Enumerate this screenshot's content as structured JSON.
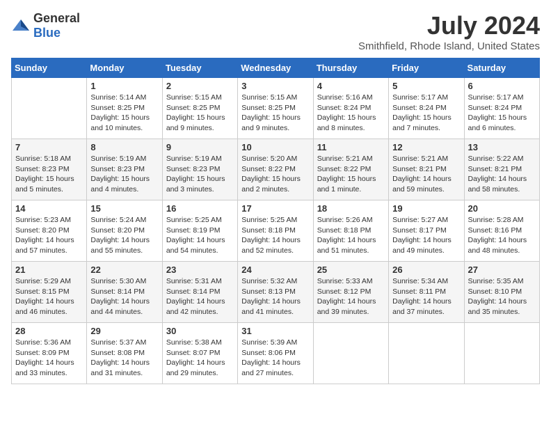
{
  "header": {
    "logo_general": "General",
    "logo_blue": "Blue",
    "month_title": "July 2024",
    "location": "Smithfield, Rhode Island, United States"
  },
  "days_of_week": [
    "Sunday",
    "Monday",
    "Tuesday",
    "Wednesday",
    "Thursday",
    "Friday",
    "Saturday"
  ],
  "weeks": [
    [
      {
        "day": "",
        "info": ""
      },
      {
        "day": "1",
        "info": "Sunrise: 5:14 AM\nSunset: 8:25 PM\nDaylight: 15 hours\nand 10 minutes."
      },
      {
        "day": "2",
        "info": "Sunrise: 5:15 AM\nSunset: 8:25 PM\nDaylight: 15 hours\nand 9 minutes."
      },
      {
        "day": "3",
        "info": "Sunrise: 5:15 AM\nSunset: 8:25 PM\nDaylight: 15 hours\nand 9 minutes."
      },
      {
        "day": "4",
        "info": "Sunrise: 5:16 AM\nSunset: 8:24 PM\nDaylight: 15 hours\nand 8 minutes."
      },
      {
        "day": "5",
        "info": "Sunrise: 5:17 AM\nSunset: 8:24 PM\nDaylight: 15 hours\nand 7 minutes."
      },
      {
        "day": "6",
        "info": "Sunrise: 5:17 AM\nSunset: 8:24 PM\nDaylight: 15 hours\nand 6 minutes."
      }
    ],
    [
      {
        "day": "7",
        "info": "Sunrise: 5:18 AM\nSunset: 8:23 PM\nDaylight: 15 hours\nand 5 minutes."
      },
      {
        "day": "8",
        "info": "Sunrise: 5:19 AM\nSunset: 8:23 PM\nDaylight: 15 hours\nand 4 minutes."
      },
      {
        "day": "9",
        "info": "Sunrise: 5:19 AM\nSunset: 8:23 PM\nDaylight: 15 hours\nand 3 minutes."
      },
      {
        "day": "10",
        "info": "Sunrise: 5:20 AM\nSunset: 8:22 PM\nDaylight: 15 hours\nand 2 minutes."
      },
      {
        "day": "11",
        "info": "Sunrise: 5:21 AM\nSunset: 8:22 PM\nDaylight: 15 hours\nand 1 minute."
      },
      {
        "day": "12",
        "info": "Sunrise: 5:21 AM\nSunset: 8:21 PM\nDaylight: 14 hours\nand 59 minutes."
      },
      {
        "day": "13",
        "info": "Sunrise: 5:22 AM\nSunset: 8:21 PM\nDaylight: 14 hours\nand 58 minutes."
      }
    ],
    [
      {
        "day": "14",
        "info": "Sunrise: 5:23 AM\nSunset: 8:20 PM\nDaylight: 14 hours\nand 57 minutes."
      },
      {
        "day": "15",
        "info": "Sunrise: 5:24 AM\nSunset: 8:20 PM\nDaylight: 14 hours\nand 55 minutes."
      },
      {
        "day": "16",
        "info": "Sunrise: 5:25 AM\nSunset: 8:19 PM\nDaylight: 14 hours\nand 54 minutes."
      },
      {
        "day": "17",
        "info": "Sunrise: 5:25 AM\nSunset: 8:18 PM\nDaylight: 14 hours\nand 52 minutes."
      },
      {
        "day": "18",
        "info": "Sunrise: 5:26 AM\nSunset: 8:18 PM\nDaylight: 14 hours\nand 51 minutes."
      },
      {
        "day": "19",
        "info": "Sunrise: 5:27 AM\nSunset: 8:17 PM\nDaylight: 14 hours\nand 49 minutes."
      },
      {
        "day": "20",
        "info": "Sunrise: 5:28 AM\nSunset: 8:16 PM\nDaylight: 14 hours\nand 48 minutes."
      }
    ],
    [
      {
        "day": "21",
        "info": "Sunrise: 5:29 AM\nSunset: 8:15 PM\nDaylight: 14 hours\nand 46 minutes."
      },
      {
        "day": "22",
        "info": "Sunrise: 5:30 AM\nSunset: 8:14 PM\nDaylight: 14 hours\nand 44 minutes."
      },
      {
        "day": "23",
        "info": "Sunrise: 5:31 AM\nSunset: 8:14 PM\nDaylight: 14 hours\nand 42 minutes."
      },
      {
        "day": "24",
        "info": "Sunrise: 5:32 AM\nSunset: 8:13 PM\nDaylight: 14 hours\nand 41 minutes."
      },
      {
        "day": "25",
        "info": "Sunrise: 5:33 AM\nSunset: 8:12 PM\nDaylight: 14 hours\nand 39 minutes."
      },
      {
        "day": "26",
        "info": "Sunrise: 5:34 AM\nSunset: 8:11 PM\nDaylight: 14 hours\nand 37 minutes."
      },
      {
        "day": "27",
        "info": "Sunrise: 5:35 AM\nSunset: 8:10 PM\nDaylight: 14 hours\nand 35 minutes."
      }
    ],
    [
      {
        "day": "28",
        "info": "Sunrise: 5:36 AM\nSunset: 8:09 PM\nDaylight: 14 hours\nand 33 minutes."
      },
      {
        "day": "29",
        "info": "Sunrise: 5:37 AM\nSunset: 8:08 PM\nDaylight: 14 hours\nand 31 minutes."
      },
      {
        "day": "30",
        "info": "Sunrise: 5:38 AM\nSunset: 8:07 PM\nDaylight: 14 hours\nand 29 minutes."
      },
      {
        "day": "31",
        "info": "Sunrise: 5:39 AM\nSunset: 8:06 PM\nDaylight: 14 hours\nand 27 minutes."
      },
      {
        "day": "",
        "info": ""
      },
      {
        "day": "",
        "info": ""
      },
      {
        "day": "",
        "info": ""
      }
    ]
  ]
}
